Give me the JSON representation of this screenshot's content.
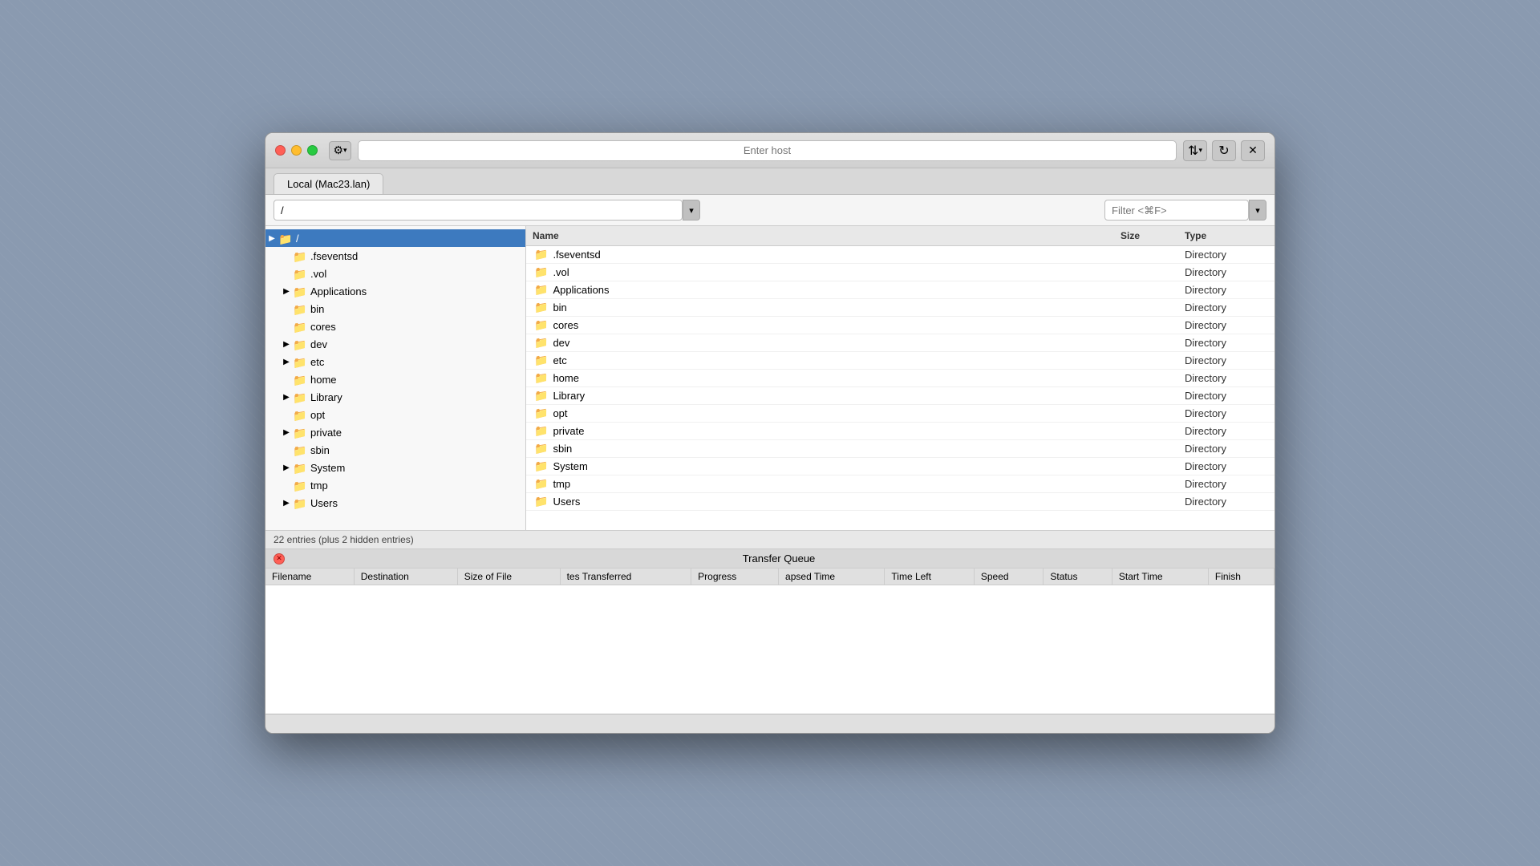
{
  "titlebar": {
    "host_placeholder": "Enter host",
    "gear_icon": "⚙",
    "transfer_toggle_icon": "⇅",
    "refresh_icon": "↻",
    "close_icon": "✕",
    "dropdown_icon": "▾"
  },
  "tabs": [
    {
      "label": "Local (Mac23.lan)"
    }
  ],
  "pathbar": {
    "path_value": "/",
    "filter_placeholder": "Filter <⌘F>"
  },
  "columns": {
    "name": "Name",
    "size": "Size",
    "type": "Type"
  },
  "tree": {
    "root_label": "/",
    "items": [
      {
        "id": "fseventsd",
        "label": ".fseventsd",
        "indent": 1,
        "expandable": false,
        "selected": false
      },
      {
        "id": "vol",
        "label": ".vol",
        "indent": 1,
        "expandable": false,
        "selected": false
      },
      {
        "id": "applications",
        "label": "Applications",
        "indent": 1,
        "expandable": true,
        "selected": false
      },
      {
        "id": "bin",
        "label": "bin",
        "indent": 1,
        "expandable": false,
        "selected": false
      },
      {
        "id": "cores",
        "label": "cores",
        "indent": 1,
        "expandable": false,
        "selected": false
      },
      {
        "id": "dev",
        "label": "dev",
        "indent": 1,
        "expandable": true,
        "selected": false
      },
      {
        "id": "etc",
        "label": "etc",
        "indent": 1,
        "expandable": true,
        "selected": false
      },
      {
        "id": "home",
        "label": "home",
        "indent": 1,
        "expandable": false,
        "selected": false
      },
      {
        "id": "library",
        "label": "Library",
        "indent": 1,
        "expandable": true,
        "selected": false
      },
      {
        "id": "opt",
        "label": "opt",
        "indent": 1,
        "expandable": false,
        "selected": false
      },
      {
        "id": "private",
        "label": "private",
        "indent": 1,
        "expandable": true,
        "selected": false
      },
      {
        "id": "sbin",
        "label": "sbin",
        "indent": 1,
        "expandable": false,
        "selected": false
      },
      {
        "id": "system",
        "label": "System",
        "indent": 1,
        "expandable": true,
        "selected": false
      },
      {
        "id": "tmp",
        "label": "tmp",
        "indent": 1,
        "expandable": false,
        "selected": false
      },
      {
        "id": "users",
        "label": "Users",
        "indent": 1,
        "expandable": true,
        "selected": false
      }
    ]
  },
  "files": [
    {
      "name": ".fseventsd",
      "size": "",
      "type": "Directory"
    },
    {
      "name": ".vol",
      "size": "",
      "type": "Directory"
    },
    {
      "name": "Applications",
      "size": "",
      "type": "Directory"
    },
    {
      "name": "bin",
      "size": "",
      "type": "Directory"
    },
    {
      "name": "cores",
      "size": "",
      "type": "Directory"
    },
    {
      "name": "dev",
      "size": "",
      "type": "Directory"
    },
    {
      "name": "etc",
      "size": "",
      "type": "Directory"
    },
    {
      "name": "home",
      "size": "",
      "type": "Directory"
    },
    {
      "name": "Library",
      "size": "",
      "type": "Directory"
    },
    {
      "name": "opt",
      "size": "",
      "type": "Directory"
    },
    {
      "name": "private",
      "size": "",
      "type": "Directory"
    },
    {
      "name": "sbin",
      "size": "",
      "type": "Directory"
    },
    {
      "name": "System",
      "size": "",
      "type": "Directory"
    },
    {
      "name": "tmp",
      "size": "",
      "type": "Directory"
    },
    {
      "name": "Users",
      "size": "",
      "type": "Directory"
    }
  ],
  "statusbar": {
    "text": "22 entries (plus 2 hidden entries)"
  },
  "transfer_queue": {
    "title": "Transfer Queue",
    "columns": [
      "Filename",
      "Destination",
      "Size of File",
      "tes Transferred",
      "Progress",
      "apsed Time",
      "Time Left",
      "Speed",
      "Status",
      "Start Time",
      "Finish"
    ]
  },
  "colors": {
    "selected_bg": "#3d7abf",
    "window_bg": "#ececec",
    "folder_color": "#5ba3e0"
  }
}
